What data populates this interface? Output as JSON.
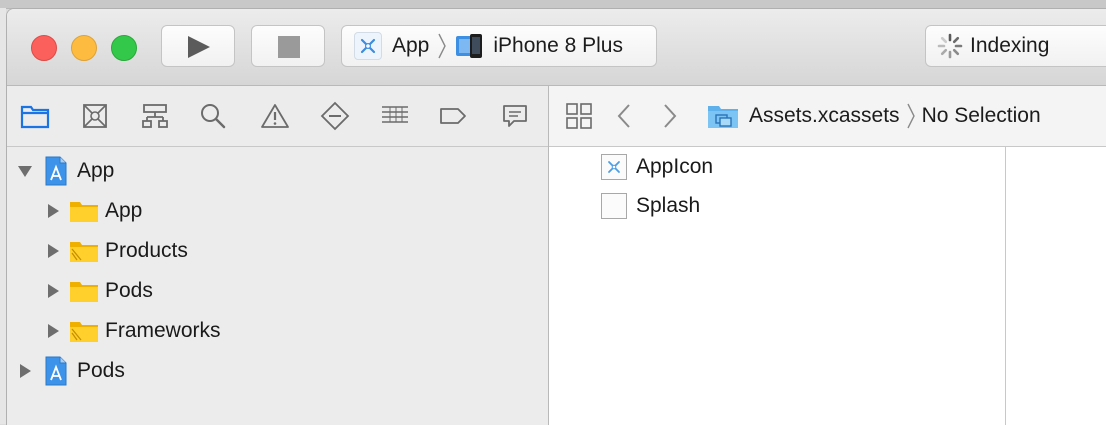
{
  "toolbar": {
    "scheme": "App",
    "destination": "iPhone 8 Plus",
    "activity_status": "Indexing"
  },
  "navigator": {
    "tabs": [
      "project-navigator",
      "source-control-navigator",
      "symbol-navigator",
      "find-navigator",
      "issue-navigator",
      "test-navigator",
      "debug-navigator",
      "breakpoint-navigator",
      "report-navigator"
    ],
    "tree": [
      {
        "label": "App",
        "level": 0,
        "expanded": true,
        "kind": "project"
      },
      {
        "label": "App",
        "level": 1,
        "expanded": false,
        "kind": "folder"
      },
      {
        "label": "Products",
        "level": 1,
        "expanded": false,
        "kind": "folder"
      },
      {
        "label": "Pods",
        "level": 1,
        "expanded": false,
        "kind": "folder"
      },
      {
        "label": "Frameworks",
        "level": 1,
        "expanded": false,
        "kind": "folder"
      },
      {
        "label": "Pods",
        "level": 0,
        "expanded": false,
        "kind": "project"
      }
    ]
  },
  "editor": {
    "breadcrumb": {
      "file": "Assets.xcassets",
      "selection": "No Selection"
    },
    "assets": [
      {
        "label": "AppIcon",
        "kind": "appicon"
      },
      {
        "label": "Splash",
        "kind": "image"
      }
    ]
  },
  "colors": {
    "folder": "#f6c624",
    "project": "#2f8ee8",
    "selected_tab": "#1b74e4",
    "close": "#fc605c",
    "minimize": "#fdbc40",
    "maximize": "#34c84a"
  }
}
